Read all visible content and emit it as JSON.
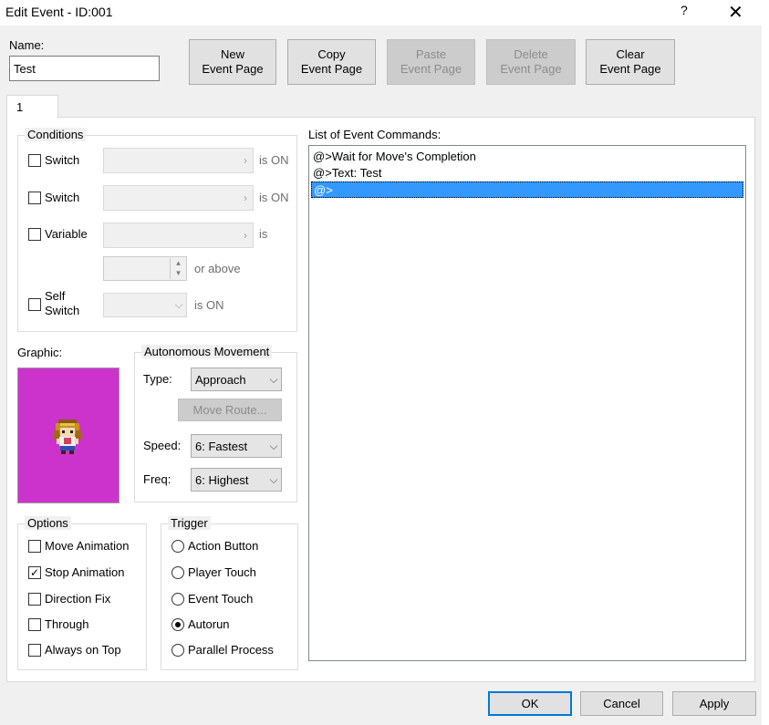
{
  "window": {
    "title": "Edit Event - ID:001",
    "help": "?",
    "close": "✕"
  },
  "name": {
    "label": "Name:",
    "value": "Test"
  },
  "toolbar": {
    "new_page": "New\nEvent Page",
    "copy_page": "Copy\nEvent Page",
    "paste_page": "Paste\nEvent Page",
    "delete_page": "Delete\nEvent Page",
    "clear_page": "Clear\nEvent Page"
  },
  "tabs": [
    {
      "label": "1"
    }
  ],
  "conditions": {
    "title": "Conditions",
    "switch1": {
      "label": "Switch",
      "suffix": "is ON",
      "checked": false
    },
    "switch2": {
      "label": "Switch",
      "suffix": "is ON",
      "checked": false
    },
    "variable": {
      "label": "Variable",
      "suffix": "is",
      "above": "or above",
      "checked": false
    },
    "self_switch": {
      "label": "Self\nSwitch",
      "suffix": "is ON",
      "checked": false
    }
  },
  "graphic": {
    "label": "Graphic:"
  },
  "movement": {
    "title": "Autonomous Movement",
    "type_label": "Type:",
    "type_value": "Approach",
    "route_button": "Move Route...",
    "speed_label": "Speed:",
    "speed_value": "6: Fastest",
    "freq_label": "Freq:",
    "freq_value": "6: Highest"
  },
  "options": {
    "title": "Options",
    "items": [
      {
        "label": "Move Animation",
        "checked": false
      },
      {
        "label": "Stop Animation",
        "checked": true
      },
      {
        "label": "Direction Fix",
        "checked": false
      },
      {
        "label": "Through",
        "checked": false
      },
      {
        "label": "Always on Top",
        "checked": false
      }
    ]
  },
  "trigger": {
    "title": "Trigger",
    "items": [
      {
        "label": "Action Button",
        "selected": false
      },
      {
        "label": "Player Touch",
        "selected": false
      },
      {
        "label": "Event Touch",
        "selected": false
      },
      {
        "label": "Autorun",
        "selected": true
      },
      {
        "label": "Parallel Process",
        "selected": false
      }
    ]
  },
  "commands": {
    "label": "List of Event Commands:",
    "items": [
      "@>Wait for Move's Completion",
      "@>Text: Test",
      "@>"
    ],
    "selected_index": 2
  },
  "footer": {
    "ok": "OK",
    "cancel": "Cancel",
    "apply": "Apply"
  },
  "colors": {
    "selection": "#3399ff",
    "graphic_bg": "#cc33cc",
    "default_border": "#0078d7"
  },
  "icons": {
    "checkmark": "✓",
    "chevron_right": "›",
    "chevron_down": "⌵",
    "spin_up": "▴",
    "spin_down": "▾"
  }
}
